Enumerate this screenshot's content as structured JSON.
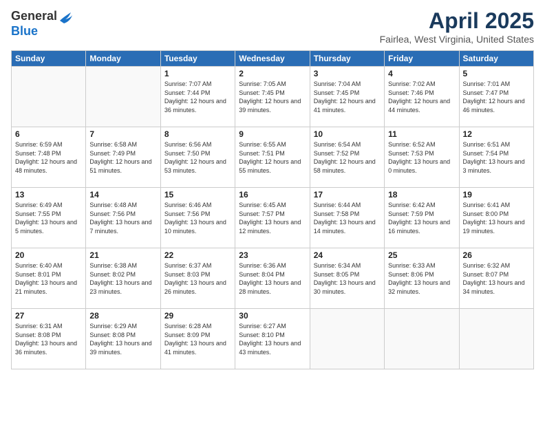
{
  "header": {
    "logo_general": "General",
    "logo_blue": "Blue",
    "month_title": "April 2025",
    "location": "Fairlea, West Virginia, United States"
  },
  "weekdays": [
    "Sunday",
    "Monday",
    "Tuesday",
    "Wednesday",
    "Thursday",
    "Friday",
    "Saturday"
  ],
  "weeks": [
    [
      {
        "day": "",
        "info": ""
      },
      {
        "day": "",
        "info": ""
      },
      {
        "day": "1",
        "sunrise": "Sunrise: 7:07 AM",
        "sunset": "Sunset: 7:44 PM",
        "daylight": "Daylight: 12 hours and 36 minutes."
      },
      {
        "day": "2",
        "sunrise": "Sunrise: 7:05 AM",
        "sunset": "Sunset: 7:45 PM",
        "daylight": "Daylight: 12 hours and 39 minutes."
      },
      {
        "day": "3",
        "sunrise": "Sunrise: 7:04 AM",
        "sunset": "Sunset: 7:45 PM",
        "daylight": "Daylight: 12 hours and 41 minutes."
      },
      {
        "day": "4",
        "sunrise": "Sunrise: 7:02 AM",
        "sunset": "Sunset: 7:46 PM",
        "daylight": "Daylight: 12 hours and 44 minutes."
      },
      {
        "day": "5",
        "sunrise": "Sunrise: 7:01 AM",
        "sunset": "Sunset: 7:47 PM",
        "daylight": "Daylight: 12 hours and 46 minutes."
      }
    ],
    [
      {
        "day": "6",
        "sunrise": "Sunrise: 6:59 AM",
        "sunset": "Sunset: 7:48 PM",
        "daylight": "Daylight: 12 hours and 48 minutes."
      },
      {
        "day": "7",
        "sunrise": "Sunrise: 6:58 AM",
        "sunset": "Sunset: 7:49 PM",
        "daylight": "Daylight: 12 hours and 51 minutes."
      },
      {
        "day": "8",
        "sunrise": "Sunrise: 6:56 AM",
        "sunset": "Sunset: 7:50 PM",
        "daylight": "Daylight: 12 hours and 53 minutes."
      },
      {
        "day": "9",
        "sunrise": "Sunrise: 6:55 AM",
        "sunset": "Sunset: 7:51 PM",
        "daylight": "Daylight: 12 hours and 55 minutes."
      },
      {
        "day": "10",
        "sunrise": "Sunrise: 6:54 AM",
        "sunset": "Sunset: 7:52 PM",
        "daylight": "Daylight: 12 hours and 58 minutes."
      },
      {
        "day": "11",
        "sunrise": "Sunrise: 6:52 AM",
        "sunset": "Sunset: 7:53 PM",
        "daylight": "Daylight: 13 hours and 0 minutes."
      },
      {
        "day": "12",
        "sunrise": "Sunrise: 6:51 AM",
        "sunset": "Sunset: 7:54 PM",
        "daylight": "Daylight: 13 hours and 3 minutes."
      }
    ],
    [
      {
        "day": "13",
        "sunrise": "Sunrise: 6:49 AM",
        "sunset": "Sunset: 7:55 PM",
        "daylight": "Daylight: 13 hours and 5 minutes."
      },
      {
        "day": "14",
        "sunrise": "Sunrise: 6:48 AM",
        "sunset": "Sunset: 7:56 PM",
        "daylight": "Daylight: 13 hours and 7 minutes."
      },
      {
        "day": "15",
        "sunrise": "Sunrise: 6:46 AM",
        "sunset": "Sunset: 7:56 PM",
        "daylight": "Daylight: 13 hours and 10 minutes."
      },
      {
        "day": "16",
        "sunrise": "Sunrise: 6:45 AM",
        "sunset": "Sunset: 7:57 PM",
        "daylight": "Daylight: 13 hours and 12 minutes."
      },
      {
        "day": "17",
        "sunrise": "Sunrise: 6:44 AM",
        "sunset": "Sunset: 7:58 PM",
        "daylight": "Daylight: 13 hours and 14 minutes."
      },
      {
        "day": "18",
        "sunrise": "Sunrise: 6:42 AM",
        "sunset": "Sunset: 7:59 PM",
        "daylight": "Daylight: 13 hours and 16 minutes."
      },
      {
        "day": "19",
        "sunrise": "Sunrise: 6:41 AM",
        "sunset": "Sunset: 8:00 PM",
        "daylight": "Daylight: 13 hours and 19 minutes."
      }
    ],
    [
      {
        "day": "20",
        "sunrise": "Sunrise: 6:40 AM",
        "sunset": "Sunset: 8:01 PM",
        "daylight": "Daylight: 13 hours and 21 minutes."
      },
      {
        "day": "21",
        "sunrise": "Sunrise: 6:38 AM",
        "sunset": "Sunset: 8:02 PM",
        "daylight": "Daylight: 13 hours and 23 minutes."
      },
      {
        "day": "22",
        "sunrise": "Sunrise: 6:37 AM",
        "sunset": "Sunset: 8:03 PM",
        "daylight": "Daylight: 13 hours and 26 minutes."
      },
      {
        "day": "23",
        "sunrise": "Sunrise: 6:36 AM",
        "sunset": "Sunset: 8:04 PM",
        "daylight": "Daylight: 13 hours and 28 minutes."
      },
      {
        "day": "24",
        "sunrise": "Sunrise: 6:34 AM",
        "sunset": "Sunset: 8:05 PM",
        "daylight": "Daylight: 13 hours and 30 minutes."
      },
      {
        "day": "25",
        "sunrise": "Sunrise: 6:33 AM",
        "sunset": "Sunset: 8:06 PM",
        "daylight": "Daylight: 13 hours and 32 minutes."
      },
      {
        "day": "26",
        "sunrise": "Sunrise: 6:32 AM",
        "sunset": "Sunset: 8:07 PM",
        "daylight": "Daylight: 13 hours and 34 minutes."
      }
    ],
    [
      {
        "day": "27",
        "sunrise": "Sunrise: 6:31 AM",
        "sunset": "Sunset: 8:08 PM",
        "daylight": "Daylight: 13 hours and 36 minutes."
      },
      {
        "day": "28",
        "sunrise": "Sunrise: 6:29 AM",
        "sunset": "Sunset: 8:08 PM",
        "daylight": "Daylight: 13 hours and 39 minutes."
      },
      {
        "day": "29",
        "sunrise": "Sunrise: 6:28 AM",
        "sunset": "Sunset: 8:09 PM",
        "daylight": "Daylight: 13 hours and 41 minutes."
      },
      {
        "day": "30",
        "sunrise": "Sunrise: 6:27 AM",
        "sunset": "Sunset: 8:10 PM",
        "daylight": "Daylight: 13 hours and 43 minutes."
      },
      {
        "day": "",
        "info": ""
      },
      {
        "day": "",
        "info": ""
      },
      {
        "day": "",
        "info": ""
      }
    ]
  ]
}
